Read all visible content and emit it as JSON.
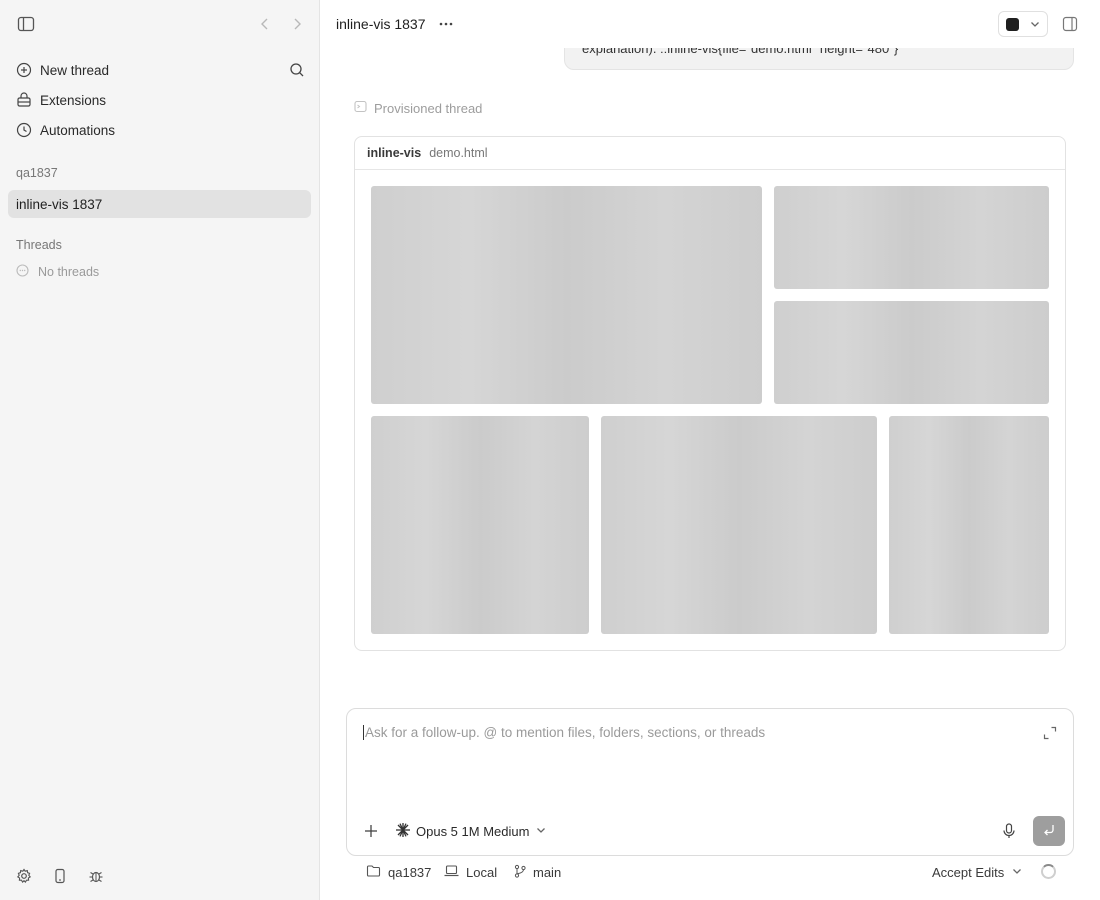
{
  "sidebar": {
    "nav": [
      {
        "label": "New thread",
        "icon": "plus-circle-icon"
      },
      {
        "label": "Extensions",
        "icon": "extensions-icon"
      },
      {
        "label": "Automations",
        "icon": "clock-icon"
      }
    ],
    "project_label": "qa1837",
    "active_thread": "inline-vis 1837",
    "threads_label": "Threads",
    "no_threads": "No threads"
  },
  "header": {
    "title": "inline-vis 1837"
  },
  "conversation": {
    "user_message_tail": "explanation). ::inline-vis{file=\"demo.html\" height=\"480\"}",
    "provisioned_label": "Provisioned thread",
    "card": {
      "kind": "inline-vis",
      "file": "demo.html"
    }
  },
  "composer": {
    "placeholder": "Ask for a follow-up. @ to mention files, folders, sections, or threads",
    "model": "Opus 5 1M Medium"
  },
  "footer": {
    "folder": "qa1837",
    "environment": "Local",
    "branch": "main",
    "mode": "Accept Edits"
  },
  "colors": {
    "send_button": "#9e9e9e",
    "active_thread_bg": "#e2e2e2",
    "sidebar_bg": "#f5f5f5"
  }
}
